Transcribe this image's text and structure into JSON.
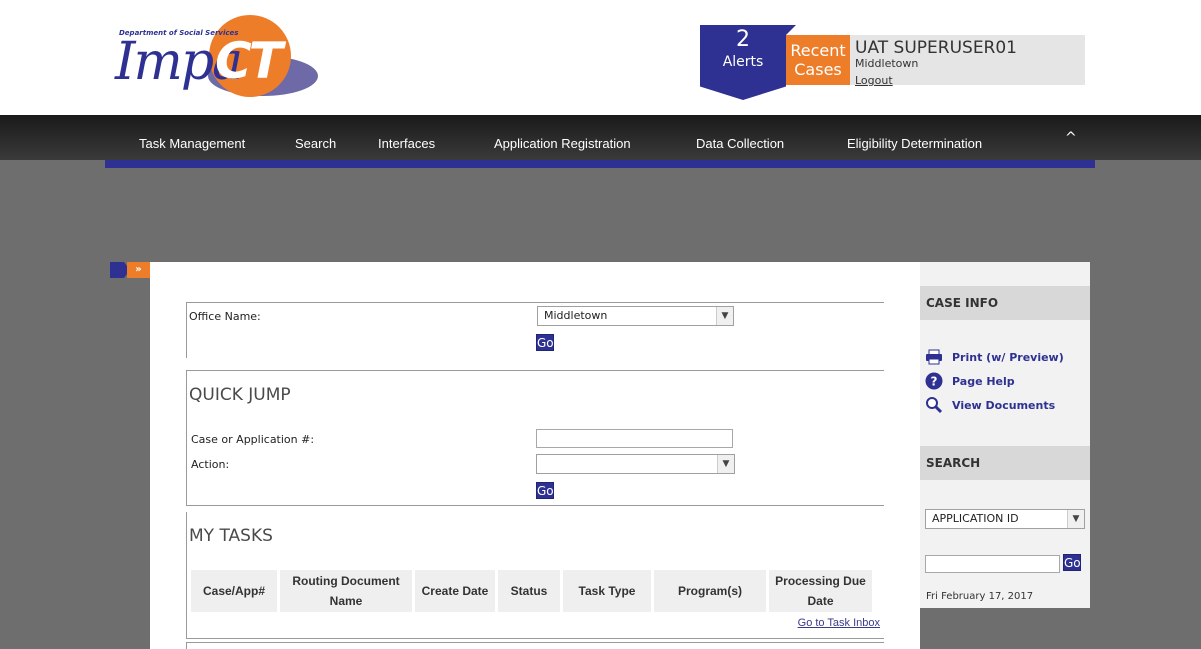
{
  "logo": {
    "dept_text": "Department of Social Services",
    "brand_left": "Impa",
    "brand_right": "CT"
  },
  "header": {
    "alerts_count": "2",
    "alerts_label": "Alerts",
    "recent_cases_line1": "Recent",
    "recent_cases_line2": "Cases",
    "user_name": "UAT SUPERUSER01",
    "user_office": "Middletown",
    "logout_label": "Logout"
  },
  "nav": {
    "items": [
      "Task Management",
      "Search",
      "Interfaces",
      "Application Registration",
      "Data Collection",
      "Eligibility Determination"
    ],
    "collapse_glyph": "^"
  },
  "sidebar_toggle_glyph": "»",
  "office": {
    "label": "Office Name:",
    "selected": "Middletown",
    "go_label": "Go"
  },
  "quick_jump": {
    "title": "QUICK JUMP",
    "case_label": "Case or Application #:",
    "case_value": "",
    "action_label": "Action:",
    "action_selected": "",
    "go_label": "Go"
  },
  "my_tasks": {
    "title": "MY TASKS",
    "columns": [
      "Case/App#",
      "Routing Document Name",
      "Create Date",
      "Status",
      "Task Type",
      "Program(s)",
      "Processing Due Date"
    ],
    "inbox_link": "Go to Task Inbox"
  },
  "case_info": {
    "title": "CASE INFO",
    "links": [
      {
        "label": "Print (w/ Preview)",
        "icon": "printer-icon"
      },
      {
        "label": "Page Help",
        "icon": "help-icon"
      },
      {
        "label": "View Documents",
        "icon": "magnifier-icon"
      }
    ]
  },
  "search": {
    "title": "SEARCH",
    "type_selected": "APPLICATION ID",
    "query": "",
    "go_label": "Go",
    "date": "Fri February 17, 2017"
  },
  "colors": {
    "brand_blue": "#2e3192",
    "brand_orange": "#ee7d2a",
    "background_gray": "#6e6e6e"
  }
}
